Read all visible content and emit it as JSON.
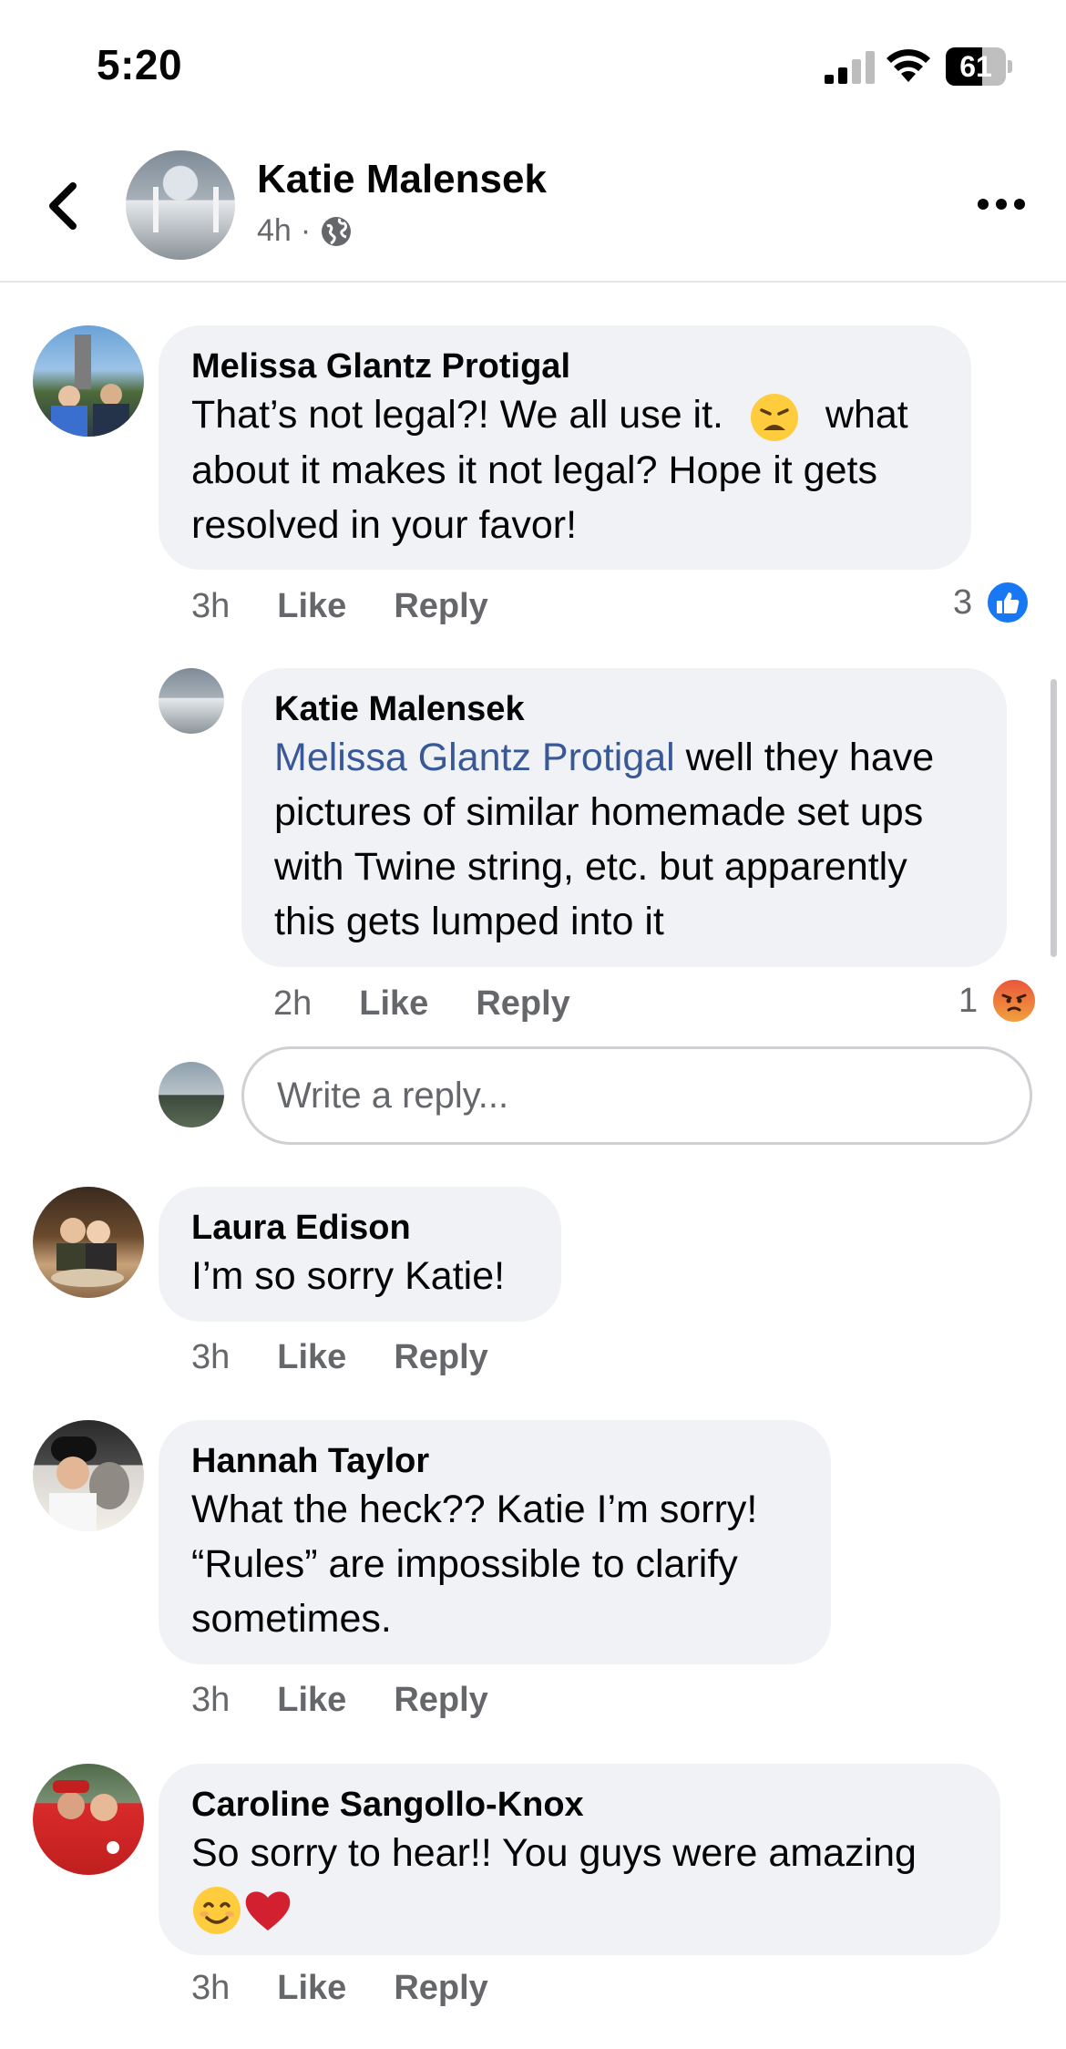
{
  "status_bar": {
    "time": "5:20",
    "battery": "61",
    "battery_level": 0.61
  },
  "header": {
    "author": "Katie Malensek",
    "time": "4h",
    "separator": "·",
    "privacy_icon": "globe-icon"
  },
  "comments": [
    {
      "name": "Melissa Glantz Protigal",
      "text_1": "That’s not legal?! We all use it.",
      "emoji_1": "weary-face-emoji",
      "text_2": "what",
      "text_3": "about it makes it not legal? Hope it gets",
      "text_4": "resolved in your favor!",
      "time": "3h",
      "like": "Like",
      "reply": "Reply",
      "reaction_count": "3",
      "reaction": "like"
    },
    {
      "name": "Katie Malensek",
      "mention": "Melissa Glantz Protigal",
      "text_1": " well they have",
      "text_2": "pictures of similar homemade set ups",
      "text_3": "with Twine string, etc. but apparently",
      "text_4": "this gets lumped into it",
      "time": "2h",
      "like": "Like",
      "reply": "Reply",
      "reaction_count": "1",
      "reaction": "angry"
    },
    {
      "name": "Laura Edison",
      "text_1": "I’m so sorry Katie!",
      "time": "3h",
      "like": "Like",
      "reply": "Reply"
    },
    {
      "name": "Hannah Taylor",
      "text_1": "What the heck?? Katie I’m sorry!",
      "text_2": "“Rules” are impossible to clarify",
      "text_3": "sometimes.",
      "time": "3h",
      "like": "Like",
      "reply": "Reply"
    },
    {
      "name": "Caroline Sangollo-Knox",
      "text_1": "So sorry to hear!! You guys were amazing",
      "emojis": [
        "smiling-face-emoji",
        "red-heart-emoji"
      ],
      "time": "3h",
      "like": "Like",
      "reply": "Reply"
    }
  ],
  "reply_box": {
    "placeholder": "Write a reply..."
  },
  "colors": {
    "mention": "#385898",
    "like_blue": "#1877f2",
    "bubble": "#f0f2f5",
    "meta_gray": "#65676b"
  }
}
